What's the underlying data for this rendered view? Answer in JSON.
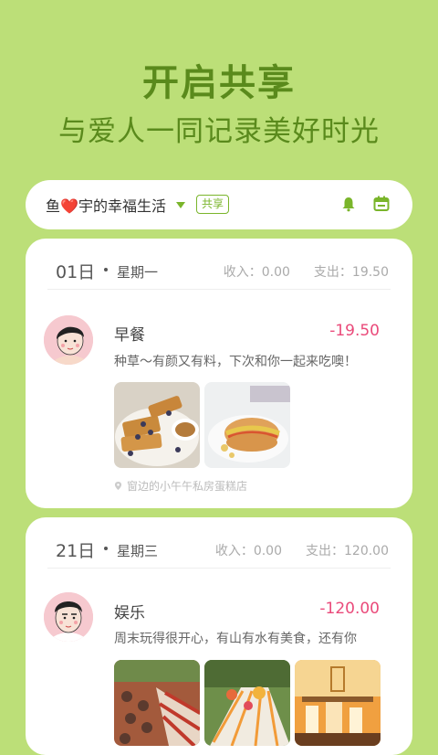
{
  "hero": {
    "title": "开启共享",
    "subtitle": "与爱人一同记录美好时光"
  },
  "book": {
    "name_prefix": "鱼",
    "heart": "❤️",
    "name_suffix": "宇的幸福生活",
    "share_tag": "共享",
    "accent": "#7ab52b",
    "icons": [
      "bell-icon",
      "calendar-icon",
      "chevron-down-icon"
    ]
  },
  "days": [
    {
      "day": "01日",
      "weekday": "星期一",
      "income": "收入：0.00",
      "expense": "支出：19.50",
      "entry": {
        "category": "早餐",
        "amount": "-19.50",
        "note": "种草～有颜又有料，下次和你一起来吃噢！",
        "location": "窗边的小午午私房蛋糕店",
        "photos": [
          "pancake-photo",
          "sandwich-photo"
        ]
      }
    },
    {
      "day": "21日",
      "weekday": "星期三",
      "income": "收入：0.00",
      "expense": "支出：120.00",
      "entry": {
        "category": "娱乐",
        "amount": "-120.00",
        "note": "周末玩得很开心，有山有水有美食，还有你",
        "photos": [
          "party-table-photo",
          "outdoor-table-photo",
          "dessert-display-photo"
        ]
      }
    }
  ],
  "colors": {
    "background": "#bcdf78",
    "title": "#5a8a1c",
    "amount": "#ea4a7a"
  }
}
